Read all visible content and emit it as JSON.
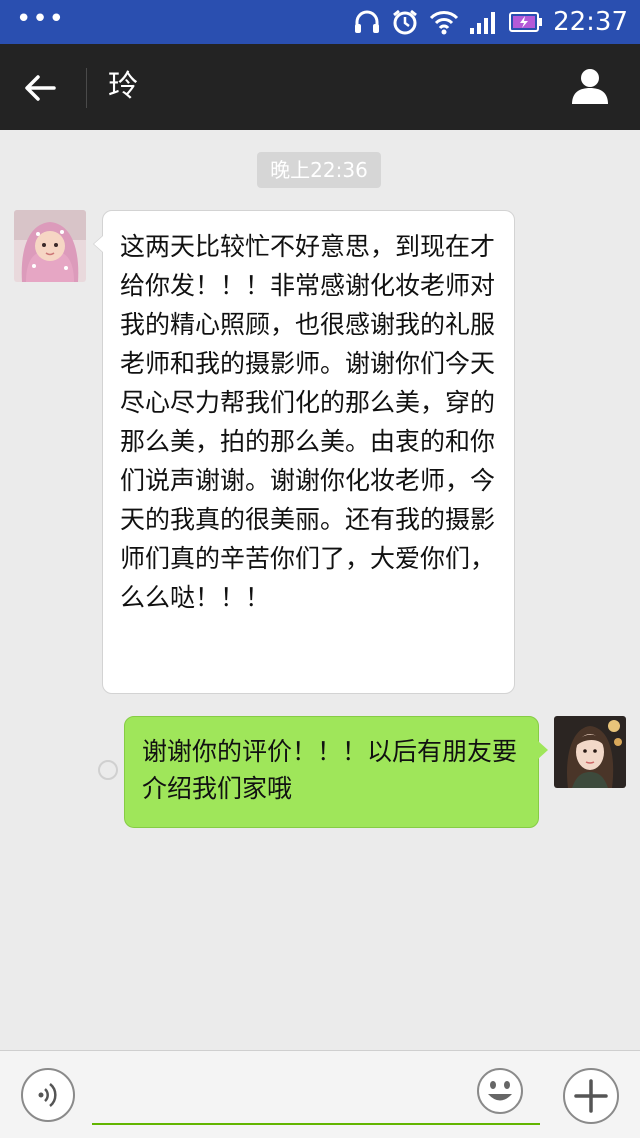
{
  "status_bar": {
    "time": "22:37",
    "menu_dots": "•••",
    "icons": [
      "headphones-icon",
      "alarm-icon",
      "wifi-icon",
      "signal-icon",
      "battery-charging-icon"
    ],
    "color": "#2a4fb0"
  },
  "header": {
    "title": "玲",
    "back_icon": "back-arrow-icon",
    "profile_icon": "person-icon"
  },
  "chat": {
    "timestamp": "晚上22:36",
    "messages": [
      {
        "side": "incoming",
        "text": "这两天比较忙不好意思，到现在才给你发！！！非常感谢化妆老师对我的精心照顾，也很感谢我的礼服老师和我的摄影师。谢谢你们今天尽心尽力帮我们化的那么美，穿的那么美，拍的那么美。由衷的和你们说声谢谢。谢谢你化妆老师，今天的我真的很美丽。还有我的摄影师们真的辛苦你们了，大爱你们，么么哒！！！"
      },
      {
        "side": "outgoing",
        "text": "谢谢你的评价！！！以后有朋友要介绍我们家哦"
      }
    ],
    "outgoing_bubble_color": "#9fe65a"
  },
  "input_bar": {
    "icons": [
      "voice-icon",
      "emoji-icon",
      "plus-icon"
    ],
    "input_value": "",
    "accent_color": "#62b500"
  }
}
